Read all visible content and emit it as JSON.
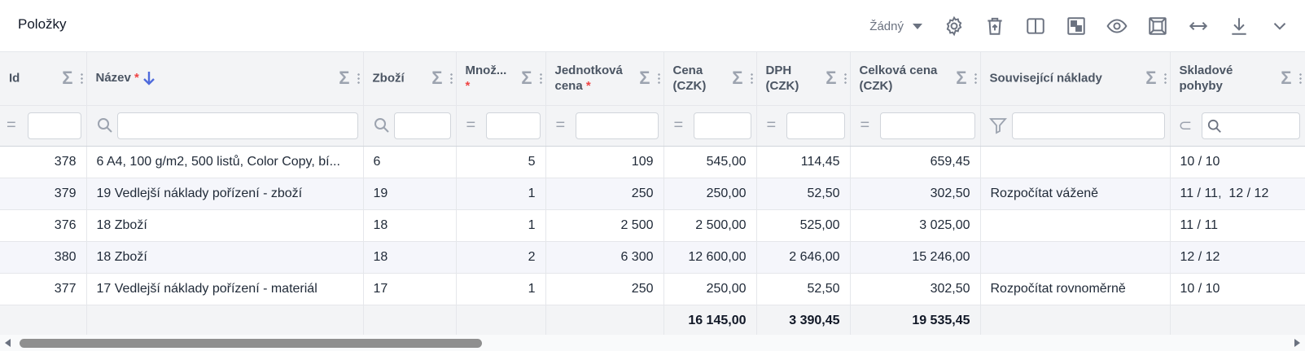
{
  "header": {
    "title": "Položky",
    "view_select": "Žádný",
    "icons": [
      "gear-icon",
      "delete-icon",
      "columns-icon",
      "layout-icon",
      "eye-icon",
      "fit-icon",
      "expand-width-icon",
      "download-icon",
      "chevron-down-icon"
    ]
  },
  "columns": [
    {
      "label": "Id",
      "required": ""
    },
    {
      "label": "Název",
      "required": "*"
    },
    {
      "label": "Zboží",
      "required": ""
    },
    {
      "label": "Množ...",
      "required": "*"
    },
    {
      "label": "Jednotková",
      "label2": "cena",
      "required": "*"
    },
    {
      "label": "Cena",
      "label2": "(CZK)",
      "required": ""
    },
    {
      "label": "DPH",
      "label2": "(CZK)",
      "required": ""
    },
    {
      "label": "Celková cena",
      "label2": "(CZK)",
      "required": ""
    },
    {
      "label": "Související náklady",
      "required": ""
    },
    {
      "label": "Skladové",
      "label2": "pohyby",
      "required": ""
    }
  ],
  "rows": [
    {
      "id": "378",
      "name": "6 A4, 100 g/m2, 500 listů, Color Copy, bí...",
      "goods": "6",
      "qty": "5",
      "unit_price": "109",
      "price": "545,00",
      "vat": "114,45",
      "total": "659,45",
      "related": "",
      "moves": [
        "10 / 10"
      ]
    },
    {
      "id": "379",
      "name": "19 Vedlejší náklady pořízení - zboží",
      "goods": "19",
      "qty": "1",
      "unit_price": "250",
      "price": "250,00",
      "vat": "52,50",
      "total": "302,50",
      "related": "Rozpočítat váženě",
      "moves": [
        "11 / 11",
        "12 / 12"
      ]
    },
    {
      "id": "376",
      "name": "18 Zboží",
      "goods": "18",
      "qty": "1",
      "unit_price": "2 500",
      "price": "2 500,00",
      "vat": "525,00",
      "total": "3 025,00",
      "related": "",
      "moves": [
        "11 / 11"
      ]
    },
    {
      "id": "380",
      "name": "18 Zboží",
      "goods": "18",
      "qty": "2",
      "unit_price": "6 300",
      "price": "12 600,00",
      "vat": "2 646,00",
      "total": "15 246,00",
      "related": "",
      "moves": [
        "12 / 12"
      ]
    },
    {
      "id": "377",
      "name": "17 Vedlejší náklady pořízení - materiál",
      "goods": "17",
      "qty": "1",
      "unit_price": "250",
      "price": "250,00",
      "vat": "52,50",
      "total": "302,50",
      "related": "Rozpočítat rovnoměrně",
      "moves": [
        "10 / 10"
      ]
    }
  ],
  "totals": {
    "price": "16 145,00",
    "vat": "3 390,45",
    "total": "19 535,45"
  },
  "colors": {
    "accent": "#5b6ad0",
    "required": "#ef4444",
    "sort_arrow": "#4f6bdc"
  }
}
